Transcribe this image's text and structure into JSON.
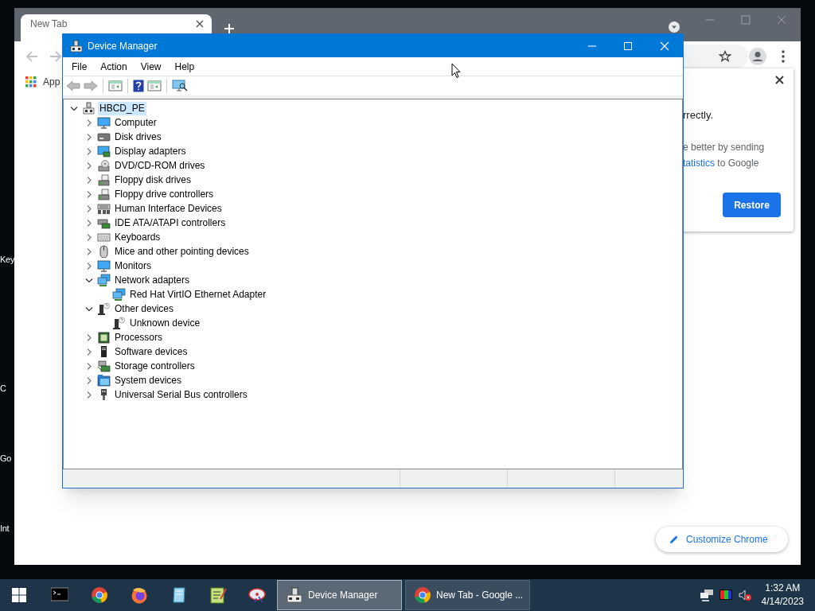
{
  "desktop": {
    "icon_labels": [
      "Key",
      "C",
      "Go",
      "Int"
    ]
  },
  "browser": {
    "tabs": [
      {
        "label": "New Tab",
        "selected": true
      }
    ],
    "bookmarks": [
      "App"
    ],
    "popup": {
      "heading": "rrectly.",
      "line_1": "e better by sending",
      "link": "tatistics",
      "line_2_rest": " to Google",
      "button": "Restore"
    },
    "customize_button": "Customize Chrome"
  },
  "device_manager": {
    "title": "Device Manager",
    "menu": [
      "File",
      "Action",
      "View",
      "Help"
    ],
    "tree": {
      "label": "HBCD_PE",
      "kind": "root",
      "selected": true,
      "expanded": true,
      "children": [
        {
          "label": "Computer",
          "kind": "computer",
          "selected": false,
          "expanded": false
        },
        {
          "label": "Disk drives",
          "kind": "disk",
          "selected": false,
          "expanded": false
        },
        {
          "label": "Display adapters",
          "kind": "display",
          "selected": false,
          "expanded": false
        },
        {
          "label": "DVD/CD-ROM drives",
          "kind": "dvd",
          "selected": false,
          "expanded": false
        },
        {
          "label": "Floppy disk drives",
          "kind": "floppy",
          "selected": false,
          "expanded": false
        },
        {
          "label": "Floppy drive controllers",
          "kind": "floppy",
          "selected": false,
          "expanded": false
        },
        {
          "label": "Human Interface Devices",
          "kind": "hid",
          "selected": false,
          "expanded": false
        },
        {
          "label": "IDE ATA/ATAPI controllers",
          "kind": "ide",
          "selected": false,
          "expanded": false
        },
        {
          "label": "Keyboards",
          "kind": "keyboard",
          "selected": false,
          "expanded": false
        },
        {
          "label": "Mice and other pointing devices",
          "kind": "mouse",
          "selected": false,
          "expanded": false
        },
        {
          "label": "Monitors",
          "kind": "computer",
          "selected": false,
          "expanded": false
        },
        {
          "label": "Network adapters",
          "kind": "network",
          "selected": false,
          "expanded": true,
          "children": [
            {
              "label": "Red Hat VirtIO Ethernet Adapter",
              "kind": "network",
              "selected": false
            }
          ]
        },
        {
          "label": "Other devices",
          "kind": "unknown",
          "selected": false,
          "expanded": true,
          "children": [
            {
              "label": "Unknown device",
              "kind": "unknown",
              "selected": false
            }
          ]
        },
        {
          "label": "Processors",
          "kind": "processor",
          "selected": false,
          "expanded": false
        },
        {
          "label": "Software devices",
          "kind": "software",
          "selected": false,
          "expanded": false
        },
        {
          "label": "Storage controllers",
          "kind": "storage",
          "selected": false,
          "expanded": false
        },
        {
          "label": "System devices",
          "kind": "system",
          "selected": false,
          "expanded": false
        },
        {
          "label": "Universal Serial Bus controllers",
          "kind": "usb",
          "selected": false,
          "expanded": false
        }
      ]
    }
  },
  "taskbar": {
    "tasks": [
      {
        "label": "Device Manager",
        "kind": "devmgr",
        "selected": true
      },
      {
        "label": "New Tab - Google ...",
        "kind": "browser",
        "selected": false
      }
    ],
    "time": "1:32 AM",
    "date": "4/14/2023"
  }
}
